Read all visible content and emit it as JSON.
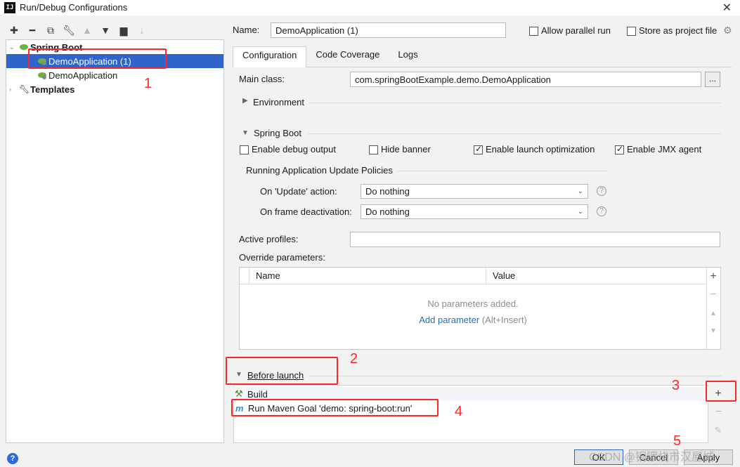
{
  "window": {
    "title": "Run/Debug Configurations",
    "icon_text": "IJ"
  },
  "toolbar": [
    "add-icon",
    "remove-icon",
    "copy-icon",
    "wrench-icon",
    "arrow-up-icon",
    "arrow-down-icon",
    "folder-icon",
    "sort-icon"
  ],
  "tree": {
    "group": "Spring Boot",
    "items": [
      "DemoApplication (1)",
      "DemoApplication"
    ],
    "templates": "Templates"
  },
  "header": {
    "name_label": "Name:",
    "name_value": "DemoApplication (1)",
    "allow_parallel": "Allow parallel run",
    "store_as_project": "Store as project file"
  },
  "tabs": [
    "Configuration",
    "Code Coverage",
    "Logs"
  ],
  "config": {
    "main_class_label": "Main class:",
    "main_class_value": "com.springBootExample.demo.DemoApplication",
    "browse_label": "...",
    "environment": "Environment",
    "spring_boot": "Spring Boot",
    "enable_debug": "Enable debug output",
    "hide_banner": "Hide banner",
    "enable_launch_opt": "Enable launch optimization",
    "enable_jmx": "Enable JMX agent",
    "policies_title": "Running Application Update Policies",
    "on_update_label": "On 'Update' action:",
    "on_update_value": "Do nothing",
    "on_frame_label": "On frame deactivation:",
    "on_frame_value": "Do nothing",
    "active_profiles_label": "Active profiles:",
    "active_profiles_value": "",
    "override_label": "Override parameters:",
    "col_name": "Name",
    "col_value": "Value",
    "no_params": "No parameters added.",
    "add_param": "Add parameter",
    "add_param_hint": "(Alt+Insert)"
  },
  "before_launch": {
    "title": "Before launch",
    "items": [
      "Build",
      "Run Maven Goal 'demo: spring-boot:run'"
    ]
  },
  "annotations": [
    "1",
    "2",
    "3",
    "4",
    "5"
  ],
  "buttons": {
    "ok": "OK",
    "cancel": "Cancel",
    "apply": "Apply",
    "help": "?"
  },
  "watermark": "CSDN @铜锣烧市汉屋城",
  "colors": {
    "selection": "#2f65ca",
    "annotation_red": "#ff2626",
    "link": "#2470b3"
  }
}
